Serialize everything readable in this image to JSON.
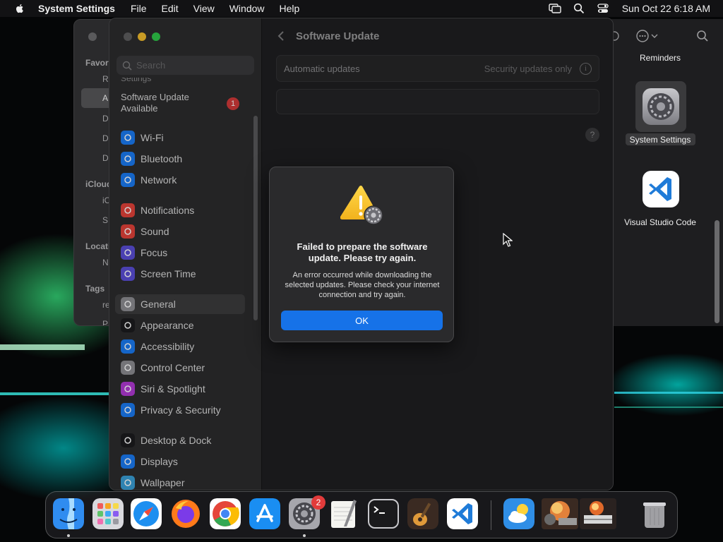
{
  "menubar": {
    "app_name": "System Settings",
    "items": [
      "File",
      "Edit",
      "View",
      "Window",
      "Help"
    ],
    "clock": "Sun Oct 22  6:18 AM"
  },
  "finder_left": {
    "sidebar_fragments": [
      "Favori",
      "R",
      "A",
      "D",
      "D",
      "D",
      "iCloud",
      "iC",
      "S",
      "Locati",
      "N",
      "Tags",
      "re",
      "P"
    ]
  },
  "finder_right": {
    "items": [
      {
        "label": "Reminders",
        "selected": false
      },
      {
        "label": "System Settings",
        "selected": true
      },
      {
        "label": "Visual Studio Code",
        "selected": false
      }
    ]
  },
  "settings": {
    "search_placeholder": "Search",
    "cut_label": "Settings",
    "update_available": "Software Update Available",
    "update_badge": "1",
    "sidebar_items": [
      {
        "label": "Wi-Fi",
        "icon": "wifi-icon",
        "color": "#1a7cf5"
      },
      {
        "label": "Bluetooth",
        "icon": "bluetooth-icon",
        "color": "#1a7cf5"
      },
      {
        "label": "Network",
        "icon": "globe-icon",
        "color": "#1a7cf5"
      },
      {
        "label": "Notifications",
        "icon": "bell-icon",
        "color": "#e5433a"
      },
      {
        "label": "Sound",
        "icon": "speaker-icon",
        "color": "#e5433a"
      },
      {
        "label": "Focus",
        "icon": "moon-icon",
        "color": "#5b4fd8"
      },
      {
        "label": "Screen Time",
        "icon": "hourglass-icon",
        "color": "#5b4fd8"
      },
      {
        "label": "General",
        "icon": "gear-icon",
        "color": "#8e8e93"
      },
      {
        "label": "Appearance",
        "icon": "appearance-icon",
        "color": "#1c1c1e"
      },
      {
        "label": "Accessibility",
        "icon": "accessibility-icon",
        "color": "#1a7cf5"
      },
      {
        "label": "Control Center",
        "icon": "control-center-icon",
        "color": "#8e8e93"
      },
      {
        "label": "Siri & Spotlight",
        "icon": "siri-icon",
        "color": "#b23ad6"
      },
      {
        "label": "Privacy & Security",
        "icon": "hand-icon",
        "color": "#1a7cf5"
      },
      {
        "label": "Desktop & Dock",
        "icon": "dock-icon",
        "color": "#1c1c1e"
      },
      {
        "label": "Displays",
        "icon": "sun-icon",
        "color": "#1a7cf5"
      },
      {
        "label": "Wallpaper",
        "icon": "wallpaper-icon",
        "color": "#3aa0d8"
      }
    ],
    "selected_item": "General",
    "content": {
      "title": "Software Update",
      "automatic_updates_label": "Automatic updates",
      "automatic_updates_value": "Security updates only",
      "info_glyph": "i",
      "help_glyph": "?"
    }
  },
  "alert": {
    "title": "Failed to prepare the software update. Please try again.",
    "message": "An error occurred while downloading the selected updates. Please check your internet connection and try again.",
    "ok_label": "OK"
  },
  "dock": {
    "apps": [
      "Finder",
      "Launchpad",
      "Safari",
      "Firefox",
      "Chrome",
      "App Store",
      "System Settings",
      "TextEdit",
      "Terminal",
      "GarageBand",
      "Visual Studio Code",
      "Weather",
      "Photo 1",
      "Photo 2",
      "Trash"
    ],
    "system_settings_badge": "2"
  }
}
